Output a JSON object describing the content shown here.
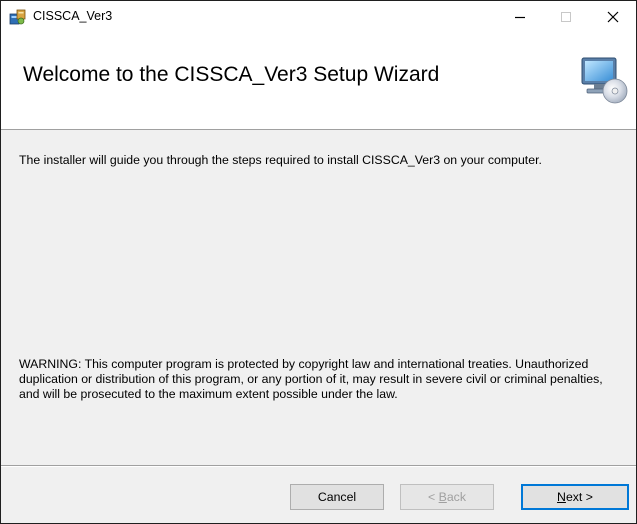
{
  "window": {
    "title": "CISSCA_Ver3"
  },
  "titlebar_buttons": {
    "minimize_icon": "minimize-icon",
    "maximize_icon": "maximize-icon",
    "close_icon": "close-icon"
  },
  "header": {
    "title": "Welcome to the CISSCA_Ver3 Setup Wizard",
    "icon": "computer-cd-icon"
  },
  "body": {
    "intro": "The installer will guide you through the steps required to install CISSCA_Ver3 on your computer.",
    "warning": "WARNING: This computer program is protected by copyright law and international treaties. Unauthorized duplication or distribution of this program, or any portion of it, may result in severe civil or criminal penalties, and will be prosecuted to the maximum extent possible under the law."
  },
  "buttons": {
    "cancel": {
      "label": "Cancel"
    },
    "back": {
      "prefix": "< ",
      "accel": "B",
      "rest": "ack"
    },
    "next": {
      "accel": "N",
      "rest": "ext >"
    }
  },
  "colors": {
    "focus_border": "#0078d7",
    "disabled_text": "#a0a0a0",
    "dialog_bg": "#f0f0f0"
  }
}
